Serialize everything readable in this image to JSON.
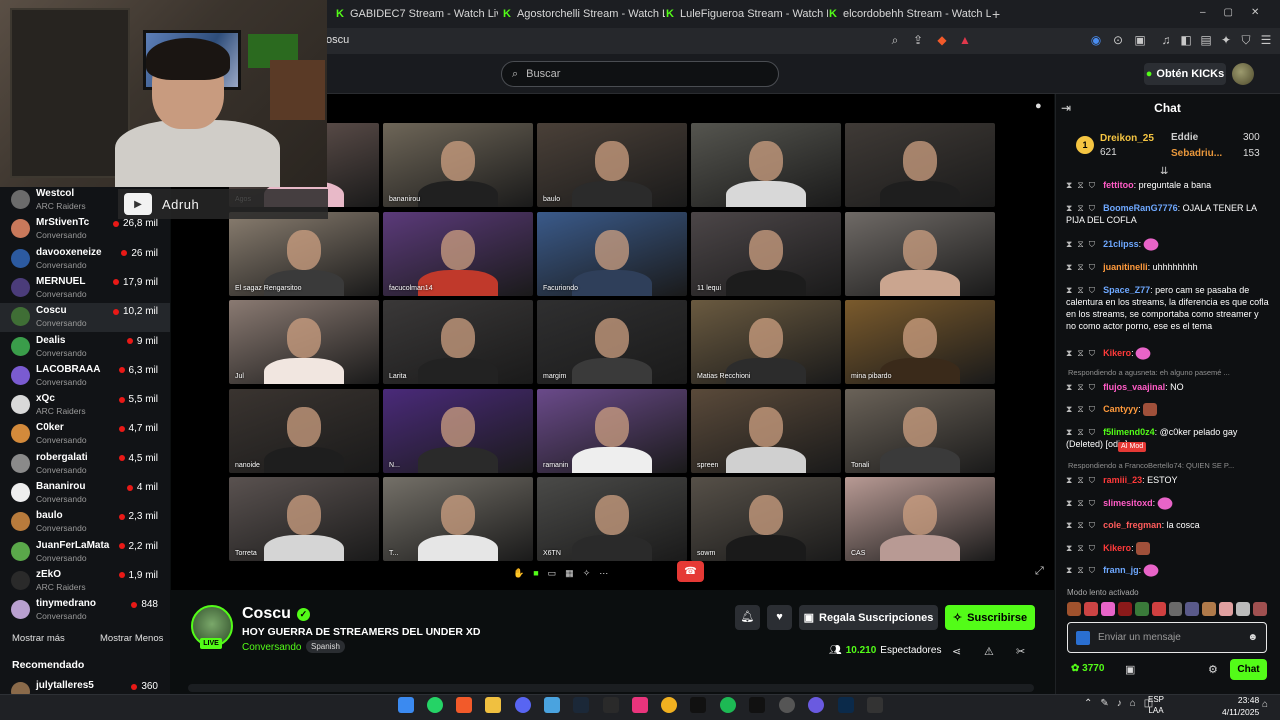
{
  "browser": {
    "tabs": [
      {
        "label": "GABIDEC7 Stream - Watch Live on Ki"
      },
      {
        "label": "Agostorchelli Stream - Watch Live on"
      },
      {
        "label": "LuleFigueroa Stream - Watch Live on"
      },
      {
        "label": "elcordobehh Stream - Watch Live on"
      }
    ],
    "new_tab": "+",
    "url": "oscu"
  },
  "header": {
    "search_placeholder": "Buscar",
    "get_kicks": "Obtén KICKs"
  },
  "overlay": {
    "name": "Adruh"
  },
  "sidebar": {
    "channels": [
      {
        "name": "Westcol",
        "sub": "ARC Raiders",
        "viewers": "",
        "color": "#6b6b6b"
      },
      {
        "name": "MrStivenTc",
        "sub": "Conversando",
        "viewers": "26,8 mil",
        "color": "#c9795b"
      },
      {
        "name": "davooxeneize",
        "sub": "Conversando",
        "viewers": "26 mil",
        "color": "#2c5aa0"
      },
      {
        "name": "MERNUEL",
        "sub": "Conversando",
        "viewers": "17,9 mil",
        "color": "#4b3c7a"
      },
      {
        "name": "Coscu",
        "sub": "Conversando",
        "viewers": "10,2 mil",
        "color": "#3f6e35"
      },
      {
        "name": "Dealis",
        "sub": "Conversando",
        "viewers": "9 mil",
        "color": "#3a9d4a"
      },
      {
        "name": "LACOBRAAA",
        "sub": "Conversando",
        "viewers": "6,3 mil",
        "color": "#7a5bd1"
      },
      {
        "name": "xQc",
        "sub": "ARC Raiders",
        "viewers": "5,5 mil",
        "color": "#d9d9d9"
      },
      {
        "name": "C0ker",
        "sub": "Conversando",
        "viewers": "4,7 mil",
        "color": "#d38a3b"
      },
      {
        "name": "robergalati",
        "sub": "Conversando",
        "viewers": "4,5 mil",
        "color": "#8a8a8a"
      },
      {
        "name": "Bananirou",
        "sub": "Conversando",
        "viewers": "4 mil",
        "color": "#eeeeee"
      },
      {
        "name": "baulo",
        "sub": "Conversando",
        "viewers": "2,3 mil",
        "color": "#b87b3c"
      },
      {
        "name": "JuanFerLaMata",
        "sub": "Conversando",
        "viewers": "2,2 mil",
        "color": "#5aa84a"
      },
      {
        "name": "zEkO",
        "sub": "ARC Raiders",
        "viewers": "1,9 mil",
        "color": "#2a2a2a"
      },
      {
        "name": "tinymedrano",
        "sub": "Conversando",
        "viewers": "848",
        "color": "#b9a0d0"
      }
    ],
    "show_more": "Mostrar más",
    "show_less": "Mostrar Menos",
    "recommended": "Recomendado",
    "rec_first": {
      "name": "julytalleres5",
      "viewers": "360"
    }
  },
  "video": {
    "tiles": [
      {
        "label": "Agos",
        "bg": "#6c5a55",
        "body": "#e8b9c8"
      },
      {
        "label": "bananirou",
        "bg": "#6e6658",
        "body": "#202020"
      },
      {
        "label": "baulo",
        "bg": "#4a4038",
        "body": "#2b2b2b"
      },
      {
        "label": "",
        "bg": "#55554f",
        "body": "#d8d8d8"
      },
      {
        "label": "",
        "bg": "#3f3a36",
        "body": "#1e1e1e"
      },
      {
        "label": "El sagaz Rengarsitoo",
        "bg": "#8a7e70",
        "body": "#3a3a3a"
      },
      {
        "label": "facucolman14",
        "bg": "#5b3a7a",
        "body": "#c0392b"
      },
      {
        "label": "Facuriondo",
        "bg": "#3a5a8a",
        "body": "#2f3f5a"
      },
      {
        "label": "11 lequi",
        "bg": "#4c4648",
        "body": "#1c1c1c"
      },
      {
        "label": "",
        "bg": "#6f6a66",
        "body": "#caa58f"
      },
      {
        "label": "Jul",
        "bg": "#8a7a72",
        "body": "#f1e6e0"
      },
      {
        "label": "Larita",
        "bg": "#3a3838",
        "body": "#222"
      },
      {
        "label": "margim",
        "bg": "#2f2f30",
        "body": "#3a3a3a"
      },
      {
        "label": "Matias Recchioni",
        "bg": "#6a5a40",
        "body": "#2c2c2c"
      },
      {
        "label": "mina pibardo",
        "bg": "#7a5a2c",
        "body": "#3a2a1a"
      },
      {
        "label": "nanoide",
        "bg": "#3a3430",
        "body": "#1e1e1e"
      },
      {
        "label": "N...",
        "bg": "#4a2a7a",
        "body": "#2a2a2a"
      },
      {
        "label": "ramanin",
        "bg": "#6a4a8a",
        "body": "#eee"
      },
      {
        "label": "spreen",
        "bg": "#5a4a3a",
        "body": "#d0d0d0"
      },
      {
        "label": "Tonali",
        "bg": "#6a6258",
        "body": "#3a3a3a"
      },
      {
        "label": "Torreta",
        "bg": "#5a5250",
        "body": "#d5d5d5"
      },
      {
        "label": "T...",
        "bg": "#747068",
        "body": "#e6e6e6"
      },
      {
        "label": "X6TN",
        "bg": "#4a4a48",
        "body": "#2a2a2a"
      },
      {
        "label": "sowm",
        "bg": "#565048",
        "body": "#1a1a1a"
      },
      {
        "label": "CAS",
        "bg": "#b89a94",
        "body": "#b89a94"
      }
    ]
  },
  "stream": {
    "channel": "Coscu",
    "live": "LIVE",
    "title": "HOY GUERRA DE STREAMERS DEL UNDER XD",
    "category": "Conversando",
    "language": "Spanish",
    "gift_label": "Regala Suscripciones",
    "subscribe_label": "Suscribirse",
    "viewers": "10.210",
    "viewers_label": "Espectadores"
  },
  "chat": {
    "title": "Chat",
    "leaders": [
      {
        "name": "Dreikon_25",
        "points": "621",
        "rank": "1",
        "color": "#f5c542"
      },
      {
        "name": "Eddie",
        "points": "300",
        "color": "#cfcfcf"
      },
      {
        "name": "Sebadriu...",
        "points": "153",
        "color": "#e9973b"
      }
    ],
    "messages": [
      {
        "user": "fettitoo",
        "color": "#ff5cc6",
        "text": ": preguntale a bana"
      },
      {
        "user": "BoomeRanG7776",
        "color": "#6ea8ff",
        "text": ": OJALA TENER LA PIJA DEL COFLA"
      },
      {
        "user": "21clipss",
        "color": "#6ea8ff",
        "text": ":"
      },
      {
        "user": "juanitinelli",
        "color": "#ff9a3c",
        "text": ": uhhhhhhhh"
      },
      {
        "user": "Space_Z77",
        "color": "#6ea8ff",
        "text": ": pero cam se pasaba de calentura en los streams, la diferencia es que cofla en los streams, se comportaba como streamer y no como actor porno, ese es el tema"
      },
      {
        "user": "Kikero",
        "color": "#ff3a3a",
        "text": ":"
      },
      {
        "user": "flujos_vaajinal",
        "color": "#ff5cc6",
        "text": ": NO"
      },
      {
        "user": "Cantyyy",
        "color": "#ff9a3c",
        "text": ":"
      },
      {
        "user": "f5limend0z4",
        "color": "#53fc18",
        "text": ": @c0ker pelado gay (Deleted) [odio]"
      },
      {
        "user": "ramiii_23",
        "color": "#ff3a3a",
        "text": ": ESTOY"
      },
      {
        "user": "slimesitoxd",
        "color": "#ff5cc6",
        "text": ":"
      },
      {
        "user": "cole_fregman",
        "color": "#ff5c5c",
        "text": ": la cosca"
      },
      {
        "user": "Kikero",
        "color": "#ff3a3a",
        "text": ":"
      },
      {
        "user": "frann_jg",
        "color": "#6ea8ff",
        "text": ":"
      }
    ],
    "replies": [
      "Respondiendo a agusneta: eh alguno pasemé ...",
      "Respondiendo a FrancoBertello74: QUIEN SE P..."
    ],
    "ai_mod": "AI Mod",
    "slow_mode": "Modo lento activado",
    "input_placeholder": "Enviar un mensaje",
    "points": "3770",
    "send_label": "Chat"
  },
  "taskbar": {
    "lang_line1": "ESP",
    "lang_line2": "LAA",
    "time": "23:48",
    "date": "4/11/2025"
  }
}
